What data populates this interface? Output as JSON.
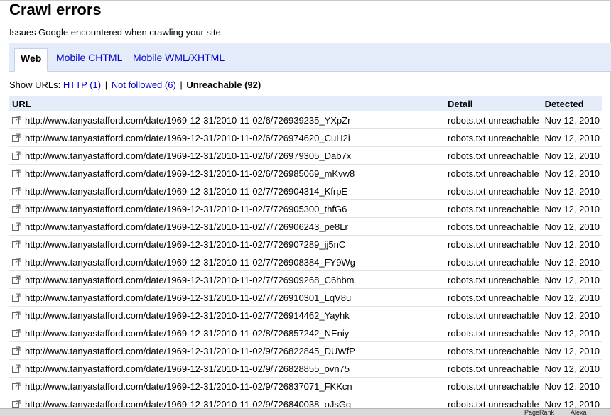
{
  "page": {
    "title": "Crawl errors",
    "subtitle": "Issues Google encountered when crawling your site."
  },
  "tabs": [
    {
      "label": "Web",
      "active": true
    },
    {
      "label": "Mobile CHTML",
      "active": false
    },
    {
      "label": "Mobile WML/XHTML",
      "active": false
    }
  ],
  "filters": {
    "prefix": "Show URLs:",
    "http": "HTTP (1)",
    "not_followed": "Not followed (6)",
    "unreachable": "Unreachable (92)",
    "separator": "|"
  },
  "table": {
    "headers": {
      "url": "URL",
      "detail": "Detail",
      "detected": "Detected"
    },
    "rows": [
      {
        "url": "http://www.tanyastafford.com/date/1969-12-31/2010-11-02/6/726939235_YXpZr",
        "detail": "robots.txt unreachable",
        "detected": "Nov 12, 2010"
      },
      {
        "url": "http://www.tanyastafford.com/date/1969-12-31/2010-11-02/6/726974620_CuH2i",
        "detail": "robots.txt unreachable",
        "detected": "Nov 12, 2010"
      },
      {
        "url": "http://www.tanyastafford.com/date/1969-12-31/2010-11-02/6/726979305_Dab7x",
        "detail": "robots.txt unreachable",
        "detected": "Nov 12, 2010"
      },
      {
        "url": "http://www.tanyastafford.com/date/1969-12-31/2010-11-02/6/726985069_mKvw8",
        "detail": "robots.txt unreachable",
        "detected": "Nov 12, 2010"
      },
      {
        "url": "http://www.tanyastafford.com/date/1969-12-31/2010-11-02/7/726904314_KfrpE",
        "detail": "robots.txt unreachable",
        "detected": "Nov 12, 2010"
      },
      {
        "url": "http://www.tanyastafford.com/date/1969-12-31/2010-11-02/7/726905300_thfG6",
        "detail": "robots.txt unreachable",
        "detected": "Nov 12, 2010"
      },
      {
        "url": "http://www.tanyastafford.com/date/1969-12-31/2010-11-02/7/726906243_pe8Lr",
        "detail": "robots.txt unreachable",
        "detected": "Nov 12, 2010"
      },
      {
        "url": "http://www.tanyastafford.com/date/1969-12-31/2010-11-02/7/726907289_jj5nC",
        "detail": "robots.txt unreachable",
        "detected": "Nov 12, 2010"
      },
      {
        "url": "http://www.tanyastafford.com/date/1969-12-31/2010-11-02/7/726908384_FY9Wg",
        "detail": "robots.txt unreachable",
        "detected": "Nov 12, 2010"
      },
      {
        "url": "http://www.tanyastafford.com/date/1969-12-31/2010-11-02/7/726909268_C6hbm",
        "detail": "robots.txt unreachable",
        "detected": "Nov 12, 2010"
      },
      {
        "url": "http://www.tanyastafford.com/date/1969-12-31/2010-11-02/7/726910301_LqV8u",
        "detail": "robots.txt unreachable",
        "detected": "Nov 12, 2010"
      },
      {
        "url": "http://www.tanyastafford.com/date/1969-12-31/2010-11-02/7/726914462_Yayhk",
        "detail": "robots.txt unreachable",
        "detected": "Nov 12, 2010"
      },
      {
        "url": "http://www.tanyastafford.com/date/1969-12-31/2010-11-02/8/726857242_NEniy",
        "detail": "robots.txt unreachable",
        "detected": "Nov 12, 2010"
      },
      {
        "url": "http://www.tanyastafford.com/date/1969-12-31/2010-11-02/9/726822845_DUWfP",
        "detail": "robots.txt unreachable",
        "detected": "Nov 12, 2010"
      },
      {
        "url": "http://www.tanyastafford.com/date/1969-12-31/2010-11-02/9/726828855_ovn75",
        "detail": "robots.txt unreachable",
        "detected": "Nov 12, 2010"
      },
      {
        "url": "http://www.tanyastafford.com/date/1969-12-31/2010-11-02/9/726837071_FKKcn",
        "detail": "robots.txt unreachable",
        "detected": "Nov 12, 2010"
      },
      {
        "url": "http://www.tanyastafford.com/date/1969-12-31/2010-11-02/9/726840038_oJsGq",
        "detail": "robots.txt unreachable",
        "detected": "Nov 12, 2010"
      }
    ]
  },
  "statusbar": {
    "pagerank": "PageRank",
    "alexa": "Alexa"
  },
  "icons": {
    "row_link": "external-link-icon"
  },
  "colors": {
    "link": "#0000cc",
    "header_bg": "#e5ecf9"
  }
}
